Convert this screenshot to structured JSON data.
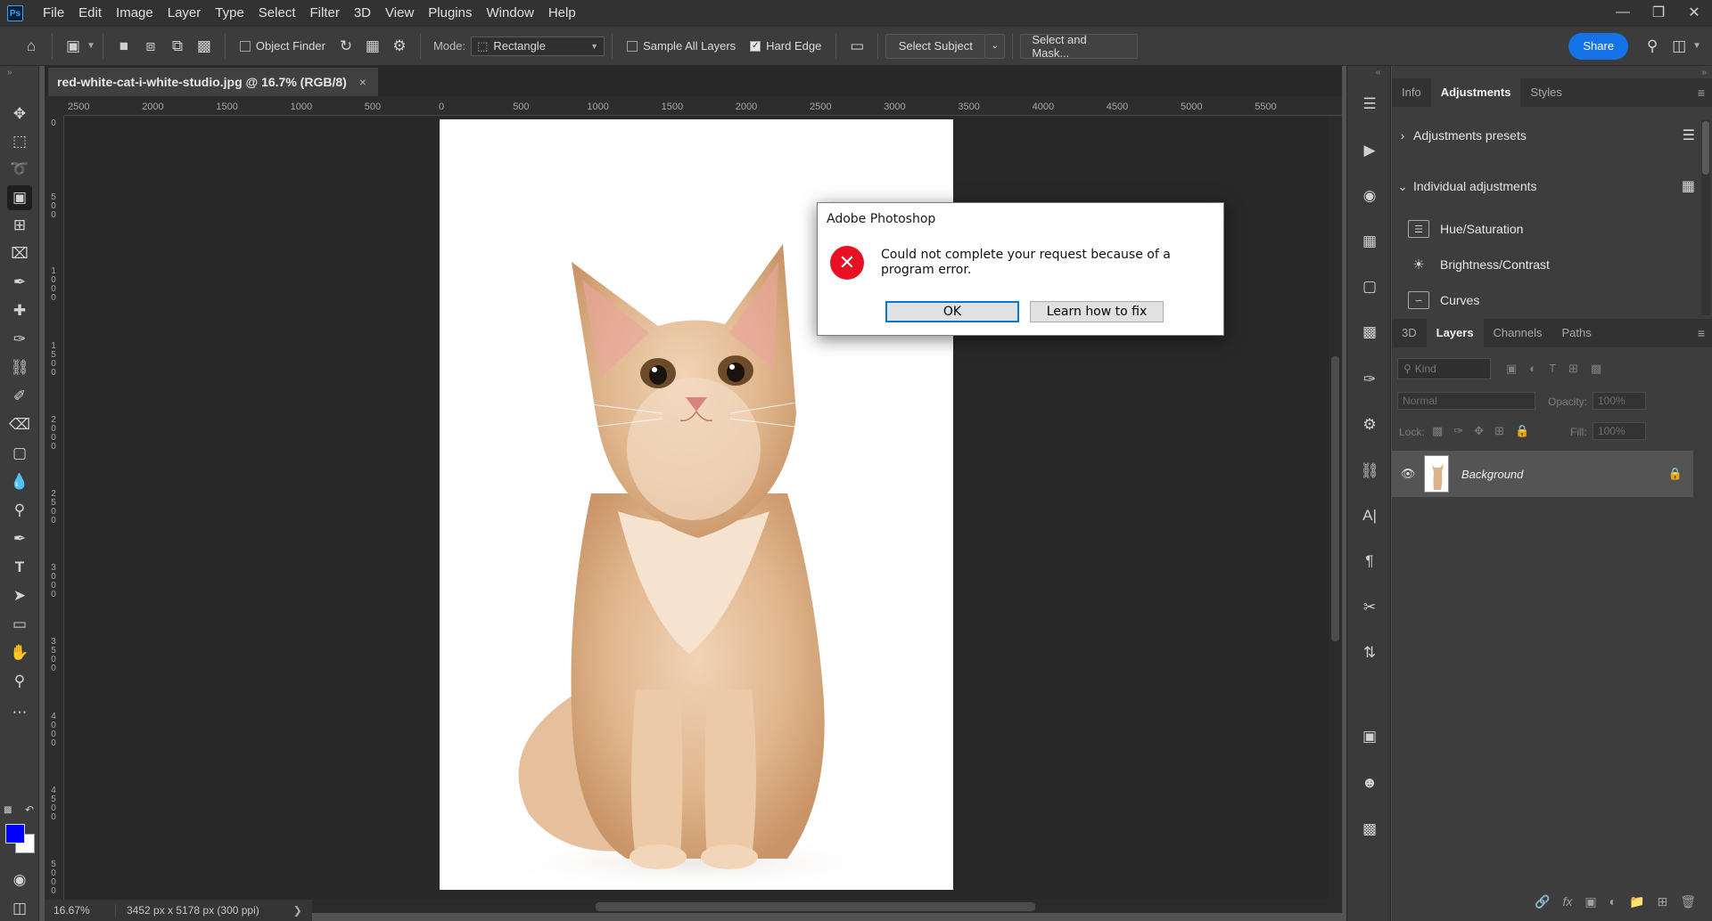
{
  "app": {
    "logo_text": "Ps",
    "menu": [
      "File",
      "Edit",
      "Image",
      "Layer",
      "Type",
      "Select",
      "Filter",
      "3D",
      "View",
      "Plugins",
      "Window",
      "Help"
    ]
  },
  "options_bar": {
    "object_finder_label": "Object Finder",
    "mode_label": "Mode:",
    "mode_value": "Rectangle",
    "sample_all_layers_label": "Sample All Layers",
    "sample_all_layers_checked": false,
    "hard_edge_label": "Hard Edge",
    "hard_edge_checked": true,
    "select_subject_label": "Select Subject",
    "select_and_mask_label": "Select and Mask...",
    "share_label": "Share"
  },
  "document": {
    "tab_title": "red-white-cat-i-white-studio.jpg @ 16.7% (RGB/8)",
    "close_glyph": "×"
  },
  "ruler": {
    "horizontal_ticks": [
      "2500",
      "2000",
      "1500",
      "1000",
      "500",
      "0",
      "500",
      "1000",
      "1500",
      "2000",
      "2500",
      "3000",
      "3500",
      "4000",
      "4500",
      "5000",
      "5500"
    ],
    "vertical_ticks": [
      "0",
      "500",
      "1000",
      "1500",
      "2000",
      "2500",
      "3000",
      "3500",
      "4000",
      "4500",
      "5000"
    ]
  },
  "status": {
    "zoom": "16.67%",
    "doc_info": "3452 px x 5178 px (300 ppi)"
  },
  "colors": {
    "foreground": "#0000ff",
    "background": "#ffffff",
    "accent": "#1473e6",
    "error": "#e81123"
  },
  "panels": {
    "top_tabs": [
      "Info",
      "Adjustments",
      "Styles"
    ],
    "top_active": "Adjustments",
    "adjustments_presets_label": "Adjustments presets",
    "individual_adjustments_label": "Individual adjustments",
    "adjustments": [
      "Hue/Saturation",
      "Brightness/Contrast",
      "Curves"
    ],
    "layer_tabs": [
      "3D",
      "Layers",
      "Channels",
      "Paths"
    ],
    "layer_active": "Layers",
    "filter_kind": "Kind",
    "blend_mode": "Normal",
    "opacity_label": "Opacity:",
    "opacity_value": "100%",
    "lock_label": "Lock:",
    "fill_label": "Fill:",
    "fill_value": "100%",
    "layers": [
      {
        "name": "Background"
      }
    ]
  },
  "dialog": {
    "title": "Adobe Photoshop",
    "message": "Could not complete your request because of a program error.",
    "ok_label": "OK",
    "learn_label": "Learn how to fix"
  }
}
